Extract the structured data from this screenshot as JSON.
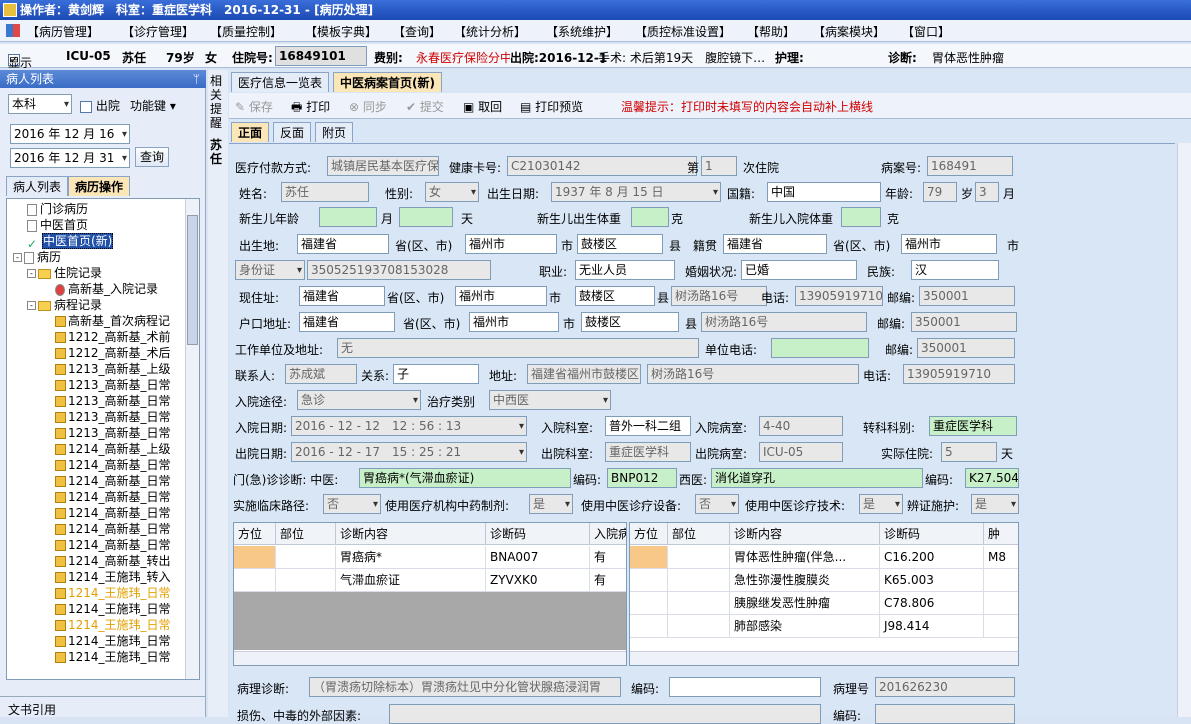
{
  "titlebar": {
    "operator": "操作者：黄剑辉　科室：重症医学科　2016-12-31 - [病历处理]"
  },
  "menu": [
    "【病历管理】",
    "【诊疗管理】",
    "【质量控制】",
    "【模板字典】",
    "【查询】",
    "【统计分析】",
    "【系统维护】",
    "【质控标准设置】",
    "【帮助】",
    "【病案模块】",
    "【窗口】"
  ],
  "infobar": {
    "show": "显示",
    "ward": "ICU-05",
    "name": "苏任",
    "age": "79岁",
    "sex": "女",
    "admit_no_label": "住院号:",
    "admit_no": "16849101",
    "fee_label": "费别:",
    "fee": "永春医疗保险分中",
    "discharge": "出院:2016-12-1",
    "surgery": "手术: 术后第19天　腹腔镜下…",
    "nursing": "护理:",
    "diag_label": "诊断:",
    "diag": "胃体恶性肿瘤"
  },
  "left": {
    "header": "病人列表",
    "pin": "ᛘ",
    "dept": "本科",
    "discharged": "出院",
    "func": "功能键",
    "date1": "2016 年 12 月 16",
    "date2": "2016 年 12 月 31",
    "query": "查询",
    "tab1": "病人列表",
    "tab2": "病历操作",
    "footer": "文书引用",
    "tree": [
      {
        "t": "门诊病历",
        "lvl": 1,
        "ico": "doc"
      },
      {
        "t": "中医首页",
        "lvl": 1,
        "ico": "doc"
      },
      {
        "t": "中医首页(新)",
        "lvl": 1,
        "ico": "check",
        "sel": true
      },
      {
        "t": "病历",
        "lvl": 0,
        "ico": "doc",
        "tog": "-"
      },
      {
        "t": "住院记录",
        "lvl": 1,
        "ico": "folder",
        "tog": "-"
      },
      {
        "t": "高新基_入院记录",
        "lvl": 3,
        "ico": "warn"
      },
      {
        "t": "病程记录",
        "lvl": 1,
        "ico": "folder",
        "tog": "-"
      },
      {
        "t": "高新基_首次病程记",
        "lvl": 3,
        "ico": "lock"
      },
      {
        "t": "1212_高新基_术前",
        "lvl": 3,
        "ico": "lock"
      },
      {
        "t": "1212_高新基_术后",
        "lvl": 3,
        "ico": "lock"
      },
      {
        "t": "1213_高新基_上级",
        "lvl": 3,
        "ico": "lock"
      },
      {
        "t": "1213_高新基_日常",
        "lvl": 3,
        "ico": "lock"
      },
      {
        "t": "1213_高新基_日常",
        "lvl": 3,
        "ico": "lock"
      },
      {
        "t": "1213_高新基_日常",
        "lvl": 3,
        "ico": "lock"
      },
      {
        "t": "1213_高新基_日常",
        "lvl": 3,
        "ico": "lock"
      },
      {
        "t": "1214_高新基_上级",
        "lvl": 3,
        "ico": "lock"
      },
      {
        "t": "1214_高新基_日常",
        "lvl": 3,
        "ico": "lock"
      },
      {
        "t": "1214_高新基_日常",
        "lvl": 3,
        "ico": "lock"
      },
      {
        "t": "1214_高新基_日常",
        "lvl": 3,
        "ico": "lock"
      },
      {
        "t": "1214_高新基_日常",
        "lvl": 3,
        "ico": "lock"
      },
      {
        "t": "1214_高新基_日常",
        "lvl": 3,
        "ico": "lock"
      },
      {
        "t": "1214_高新基_日常",
        "lvl": 3,
        "ico": "lock"
      },
      {
        "t": "1214_高新基_转出",
        "lvl": 3,
        "ico": "lock"
      },
      {
        "t": "1214_王施玮_转入",
        "lvl": 3,
        "ico": "lock"
      },
      {
        "t": "1214_王施玮_日常",
        "lvl": 3,
        "ico": "lock",
        "orange": true
      },
      {
        "t": "1214_王施玮_日常",
        "lvl": 3,
        "ico": "lock"
      },
      {
        "t": "1214_王施玮_日常",
        "lvl": 3,
        "ico": "lock",
        "orange": true
      },
      {
        "t": "1214_王施玮_日常",
        "lvl": 3,
        "ico": "lock"
      },
      {
        "t": "1214_王施玮_日常",
        "lvl": 3,
        "ico": "lock"
      }
    ]
  },
  "sidetab": {
    "t1": "相关提醒",
    "t2": "苏任"
  },
  "tabs": {
    "t1": "医疗信息一览表",
    "t2": "中医病案首页(新)"
  },
  "toolbar": {
    "save": "保存",
    "print": "打印",
    "sync": "同步",
    "submit": "提交",
    "retrieve": "取回",
    "preview": "打印预览",
    "tip": "温馨提示：打印时未填写的内容会自动补上横线"
  },
  "subtabs": {
    "s1": "正面",
    "s2": "反面",
    "s3": "附页"
  },
  "form": {
    "pay_label": "医疗付款方式:",
    "pay": "城镇居民基本医疗保险",
    "card_label": "健康卡号:",
    "card": "C21030142",
    "di": "第",
    "times": "1",
    "ci": "次住院",
    "case_label": "病案号:",
    "case": "168491",
    "name_label": "姓名:",
    "name": "苏任",
    "sex_label": "性别:",
    "sex": "女",
    "birth_label": "出生日期:",
    "birth": "1937 年 8 月 15 日",
    "nation_label": "国籍:",
    "nation": "中国",
    "age_label": "年龄:",
    "age": "79",
    "sui": "岁",
    "month": "3",
    "yue": "月",
    "nb_age_label": "新生儿年龄",
    "yue2": "月",
    "tian": "天",
    "nb_bw_label": "新生儿出生体重",
    "ke": "克",
    "nb_aw_label": "新生儿入院体重",
    "ke2": "克",
    "bp_label": "出生地:",
    "bp_prov": "福建省",
    "prov_city": "省(区、市)",
    "bp_city": "福州市",
    "shi": "市",
    "bp_dist": "鼓楼区",
    "xian": "县",
    "jg_label": "籍贯",
    "jg_prov": "福建省",
    "jg_city": "福州市",
    "shi2": "市",
    "idtype": "身份证",
    "idno": "350525193708153028",
    "job_label": "职业:",
    "job": "无业人员",
    "mar_label": "婚姻状况:",
    "mar": "已婚",
    "eth_label": "民族:",
    "eth": "汉",
    "addr_label": "现住址:",
    "addr_prov": "福建省",
    "addr_city": "福州市",
    "addr_dist": "鼓楼区",
    "addr_street": "树汤路16号",
    "tel_label": "电话:",
    "tel": "13905919710",
    "zip_label": "邮编:",
    "zip": "350001",
    "hk_label": "户口地址:",
    "hk_prov": "福建省",
    "hk_city": "福州市",
    "hk_dist": "鼓楼区",
    "hk_street": "树汤路16号",
    "hk_zip": "350001",
    "work_label": "工作单位及地址:",
    "work": "无",
    "wtel_label": "单位电话:",
    "wzip": "350001",
    "contact_label": "联系人:",
    "contact": "苏成斌",
    "rel_label": "关系:",
    "rel": "子",
    "caddr_label": "地址:",
    "caddr": "福建省福州市鼓楼区",
    "caddr2": "树汤路16号",
    "ctel": "13905919710",
    "route_label": "入院途径:",
    "route": "急诊",
    "treat_label": "治疗类别",
    "treat": "中西医",
    "adate_label": "入院日期:",
    "adate": "2016 - 12 - 12　12 : 56 : 13",
    "adept_label": "入院科室:",
    "adept": "普外一科二组",
    "aroom_label": "入院病室:",
    "aroom": "4-40",
    "tdept_label": "转科科别:",
    "tdept": "重症医学科",
    "ddate_label": "出院日期:",
    "ddate": "2016 - 12 - 17　15 : 25 : 21",
    "ddept_label": "出院科室:",
    "ddept": "重症医学科",
    "droom_label": "出院病室:",
    "droom": "ICU-05",
    "days_label": "实际住院:",
    "days": "5",
    "tian2": "天",
    "od_label": "门(急)诊诊断: 中医:",
    "od_tcm": "胃癌病*(气滞血瘀证)",
    "code_label": "编码:",
    "od_tcm_code": "BNP012",
    "wm_label": "西医:",
    "od_wm": "消化道穿孔",
    "od_wm_code": "K27.504",
    "cp_label": "实施临床路径:",
    "cp": "否",
    "herb_label": "使用医疗机构中药制剂:",
    "herb": "是",
    "equip_label": "使用中医诊疗设备:",
    "equip": "否",
    "tech_label": "使用中医诊疗技术:",
    "tech": "是",
    "nurse_label": "辨证施护:",
    "nurse": "是",
    "path_label": "病理诊断:",
    "path": "（胃溃疡切除标本）胃溃疡灶见中分化管状腺癌浸润胃",
    "path_code": "",
    "path_no_label": "病理号",
    "path_no": "201626230",
    "injury_label": "损伤、中毒的外部因素:"
  },
  "grid1": {
    "headers": [
      "方位",
      "部位",
      "诊断内容",
      "诊断码",
      "入院病"
    ],
    "rows": [
      [
        "",
        "",
        "胃癌病*",
        "BNA007",
        "有"
      ],
      [
        "",
        "",
        "气滞血瘀证",
        "ZYVXK0",
        "有"
      ]
    ]
  },
  "grid2": {
    "headers": [
      "方位",
      "部位",
      "诊断内容",
      "诊断码",
      "肿"
    ],
    "rows": [
      [
        "",
        "",
        "胃体恶性肿瘤(伴急...",
        "C16.200",
        "M8"
      ],
      [
        "",
        "",
        "急性弥漫性腹膜炎",
        "K65.003",
        ""
      ],
      [
        "",
        "",
        "胰腺继发恶性肿瘤",
        "C78.806",
        ""
      ],
      [
        "",
        "",
        "肺部感染",
        "J98.414",
        ""
      ]
    ]
  }
}
